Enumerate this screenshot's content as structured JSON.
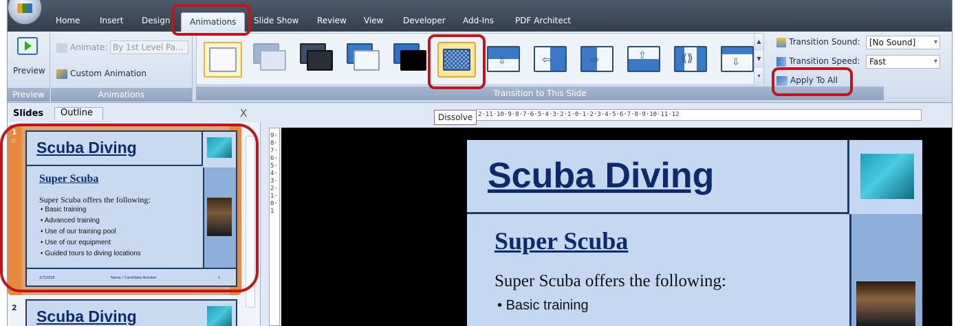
{
  "tabs": [
    "Home",
    "Insert",
    "Design",
    "Animations",
    "Slide Show",
    "Review",
    "View",
    "Developer",
    "Add-Ins",
    "PDF Architect"
  ],
  "active_tab": "Animations",
  "preview_group": {
    "button": "Preview",
    "label": "Preview"
  },
  "animations_group": {
    "animate_label": "Animate:",
    "animate_value": "By 1st Level Pa...",
    "custom_animation": "Custom Animation",
    "label": "Animations"
  },
  "transition_group": {
    "label": "Transition to This Slide",
    "sound_label": "Transition Sound:",
    "sound_value": "[No Sound]",
    "speed_label": "Transition Speed:",
    "speed_value": "Fast",
    "apply_all": "Apply To All"
  },
  "tooltip": "Dissolve",
  "pane_tabs": {
    "slides": "Slides",
    "outline": "Outline",
    "close": "X"
  },
  "ruler_h": "2·11·10·9·8·7·6·5·4·3·2·1·0·1·2·3·4·5·6·7·8·9·10·11·12",
  "ruler_v": "9·8·7·6·5·4·3·2·1·0·1",
  "slide1": {
    "number": "1",
    "title": "Scuba Diving",
    "subtitle": "Super Scuba",
    "intro": "Super Scuba offers the following:",
    "bullets": [
      "Basic training",
      "Advanced training",
      "Use of our training pool",
      "Use of our equipment",
      "Guided tours to diving locations"
    ],
    "footer_date": "1/7/2018",
    "footer_center": "Name / Candidate Number",
    "footer_page": "1"
  },
  "slide2": {
    "number": "2",
    "title": "Scuba Diving"
  },
  "main_slide": {
    "title": "Scuba Diving",
    "subtitle": "Super Scuba",
    "intro": "Super Scuba offers the following:",
    "bullet1": "Basic training"
  },
  "colors": {
    "highlight": "#c0151d",
    "title_blue": "#0e2a6b",
    "slide_bg": "#c6d8f1"
  }
}
